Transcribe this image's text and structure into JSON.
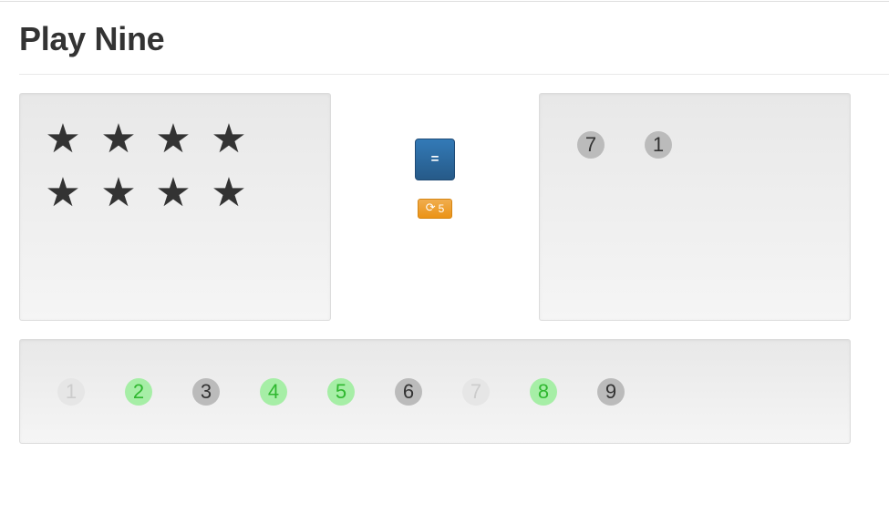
{
  "header": {
    "title": "Play Nine"
  },
  "stars": {
    "count": 8,
    "glyph": "★"
  },
  "controls": {
    "check_label": "=",
    "redraw_icon": "refresh-icon",
    "redraw_glyph": "⟳",
    "redraws_left": "5"
  },
  "answer": {
    "selected": [
      {
        "label": "7"
      },
      {
        "label": "1"
      }
    ]
  },
  "numbers": {
    "items": [
      {
        "label": "1",
        "state": "used"
      },
      {
        "label": "2",
        "state": "correct"
      },
      {
        "label": "3",
        "state": "available"
      },
      {
        "label": "4",
        "state": "correct"
      },
      {
        "label": "5",
        "state": "correct"
      },
      {
        "label": "6",
        "state": "available"
      },
      {
        "label": "7",
        "state": "used"
      },
      {
        "label": "8",
        "state": "correct"
      },
      {
        "label": "9",
        "state": "available"
      }
    ]
  },
  "colors": {
    "check_button": "#337ab7",
    "redraw_button": "#f0ad4e",
    "correct_number_bg": "#a6eea6",
    "correct_number_text": "#2fb82f",
    "selected_number_bg": "#bbbbbb",
    "used_number_bg": "#e6e6e6"
  }
}
